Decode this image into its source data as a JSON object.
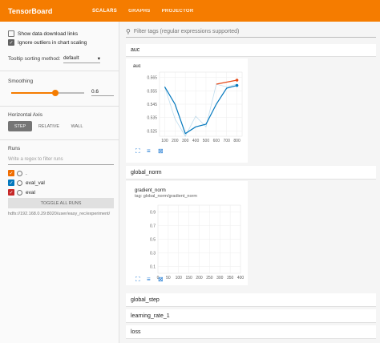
{
  "app": {
    "title": "TensorBoard",
    "tabs": [
      "SCALARS",
      "GRAPHS",
      "PROJECTOR"
    ]
  },
  "sidebar": {
    "show_download_label": "Show data download links",
    "show_download_checked": false,
    "ignore_outliers_label": "Ignore outliers in chart scaling",
    "ignore_outliers_checked": true,
    "tooltip_label": "Tooltip sorting method:",
    "tooltip_value": "default",
    "smoothing_label": "Smoothing",
    "smoothing_value": "0.6",
    "smoothing_fraction": 0.6,
    "axis_label": "Horizontal Axis",
    "axis_options": [
      "STEP",
      "RELATIVE",
      "WALL"
    ],
    "axis_selected": "STEP",
    "runs_label": "Runs",
    "runs_filter_placeholder": "Write a regex to filter runs",
    "runs": [
      {
        "name": ".",
        "color": "#ef6c00"
      },
      {
        "name": "eval_val",
        "color": "#0277bd"
      },
      {
        "name": "eval",
        "color": "#c62828"
      }
    ],
    "toggle_label": "TOGGLE ALL RUNS",
    "run_path": "hdfs://192.168.0.29:8020/user/easy_rec/experiment/"
  },
  "main": {
    "filter_placeholder": "Filter tags (regular expressions supported)",
    "sections": [
      "auc",
      "global_norm",
      "global_step",
      "learning_rate_1",
      "loss"
    ]
  },
  "chart_data": [
    {
      "type": "line",
      "title": "auc",
      "x_ticks": [
        "100",
        "200",
        "300",
        "400",
        "500",
        "600",
        "700",
        "800"
      ],
      "y_ticks": [
        "0.565",
        "0.555",
        "0.545",
        "0.535",
        "0.525"
      ],
      "ylim": [
        0.521,
        0.569
      ],
      "xlim": [
        50,
        850
      ],
      "series": [
        {
          "name": "eval_val",
          "color": "#0277bd",
          "x": [
            100,
            200,
            300,
            400,
            500,
            600,
            700,
            800
          ],
          "y": [
            0.558,
            0.545,
            0.523,
            0.528,
            0.53,
            0.545,
            0.557,
            0.559
          ],
          "raw": [
            0.558,
            0.534,
            0.521,
            0.536,
            0.528,
            0.56,
            0.558,
            0.56
          ]
        },
        {
          "name": "eval",
          "color": "#e64a19",
          "x": [
            600,
            800
          ],
          "y": [
            0.56,
            0.563
          ]
        }
      ]
    },
    {
      "type": "line",
      "title": "gradient_norm",
      "tag": "tag: global_norm/gradient_norm",
      "x_ticks": [
        "0",
        "50",
        "100",
        "150",
        "200",
        "250",
        "300",
        "350",
        "400"
      ],
      "y_ticks": [
        "0.9",
        "0.7",
        "0.5",
        "0.3",
        "0.1"
      ],
      "ylim": [
        0,
        1
      ],
      "xlim": [
        0,
        400
      ],
      "series": []
    }
  ]
}
